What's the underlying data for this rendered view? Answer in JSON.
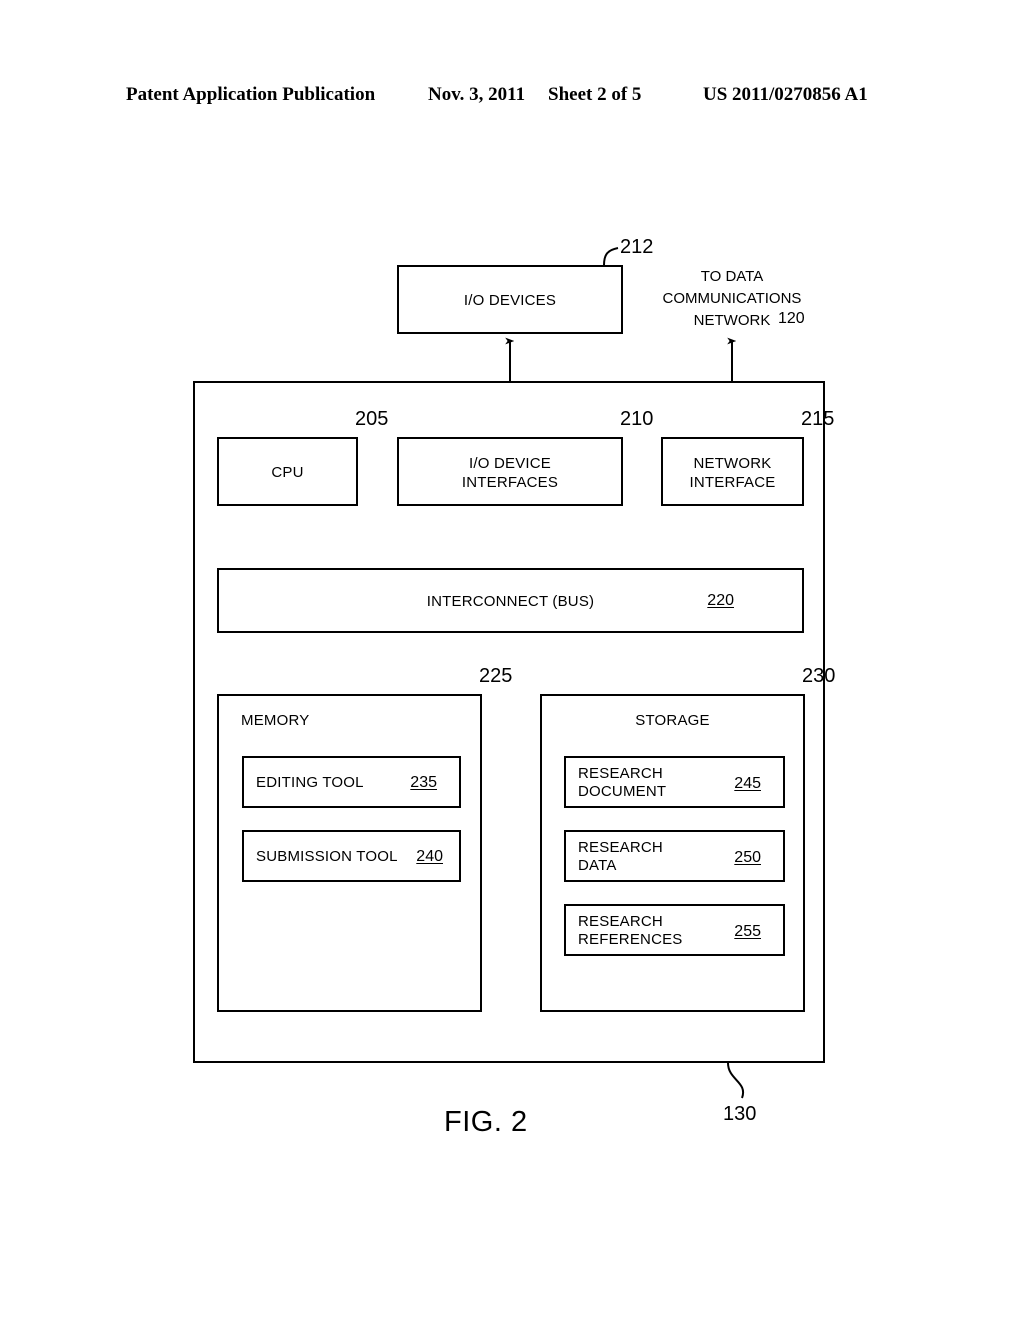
{
  "header": {
    "publication": "Patent Application Publication",
    "date": "Nov. 3, 2011",
    "sheet": "Sheet 2 of 5",
    "patent_number": "US 2011/0270856 A1"
  },
  "figure": {
    "caption": "FIG. 2",
    "system_ref": "130"
  },
  "network_caption": {
    "text": "TO DATA\nCOMMUNICATIONS\nNETWORK",
    "ref": "120"
  },
  "blocks": {
    "io_devices": {
      "label": "I/O DEVICES",
      "ref": "212"
    },
    "cpu": {
      "label": "CPU",
      "ref": "205"
    },
    "io_device_interfaces": {
      "label": "I/O DEVICE\nINTERFACES",
      "ref": "210"
    },
    "network_interface": {
      "label": "NETWORK\nINTERFACE",
      "ref": "215"
    },
    "interconnect": {
      "label": "INTERCONNECT (BUS)",
      "ref": "220"
    },
    "memory": {
      "label": "MEMORY",
      "ref": "225"
    },
    "storage": {
      "label": "STORAGE",
      "ref": "230"
    }
  },
  "memory_components": [
    {
      "label": "EDITING TOOL",
      "ref": "235"
    },
    {
      "label": "SUBMISSION TOOL",
      "ref": "240"
    }
  ],
  "storage_components": [
    {
      "label": "RESEARCH\nDOCUMENT",
      "ref": "245"
    },
    {
      "label": "RESEARCH\nDATA",
      "ref": "250"
    },
    {
      "label": "RESEARCH\nREFERENCES",
      "ref": "255"
    }
  ],
  "colors": {
    "ink": "#000000",
    "paper": "#ffffff"
  }
}
